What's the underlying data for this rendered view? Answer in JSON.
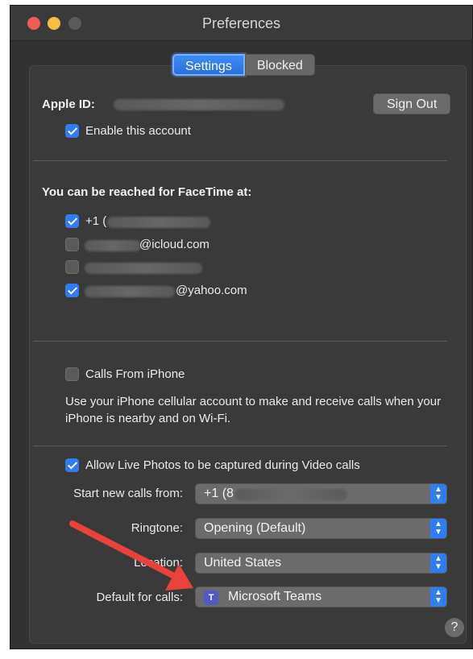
{
  "window": {
    "title": "Preferences"
  },
  "tabs": [
    {
      "label": "Settings",
      "active": true
    },
    {
      "label": "Blocked",
      "active": false
    }
  ],
  "account": {
    "apple_id_label": "Apple ID:",
    "sign_out_label": "Sign Out",
    "enable_label": "Enable this account",
    "enable_checked": true
  },
  "reach": {
    "heading": "You can be reached for FaceTime at:",
    "items": [
      {
        "visible_text": "+1 (",
        "checked": true
      },
      {
        "visible_text": "@icloud.com",
        "checked": false
      },
      {
        "visible_text": "",
        "checked": false
      },
      {
        "visible_text": "@yahoo.com",
        "checked": true
      }
    ]
  },
  "iphone": {
    "calls_label": "Calls From iPhone",
    "calls_checked": false,
    "description": "Use your iPhone cellular account to make and receive calls when your iPhone is nearby and on Wi-Fi."
  },
  "options": {
    "live_photos_label": "Allow Live Photos to be captured during Video calls",
    "live_photos_checked": true,
    "start_calls_label": "Start new calls from:",
    "start_calls_value": "+1 (8",
    "ringtone_label": "Ringtone:",
    "ringtone_value": "Opening (Default)",
    "location_label": "Location:",
    "location_value": "United States",
    "default_calls_label": "Default for calls:",
    "default_calls_value": "Microsoft Teams"
  },
  "help_label": "?",
  "colors": {
    "accent": "#2f7df4",
    "annotation_arrow": "#e8423a",
    "window_bg": "#323232"
  }
}
